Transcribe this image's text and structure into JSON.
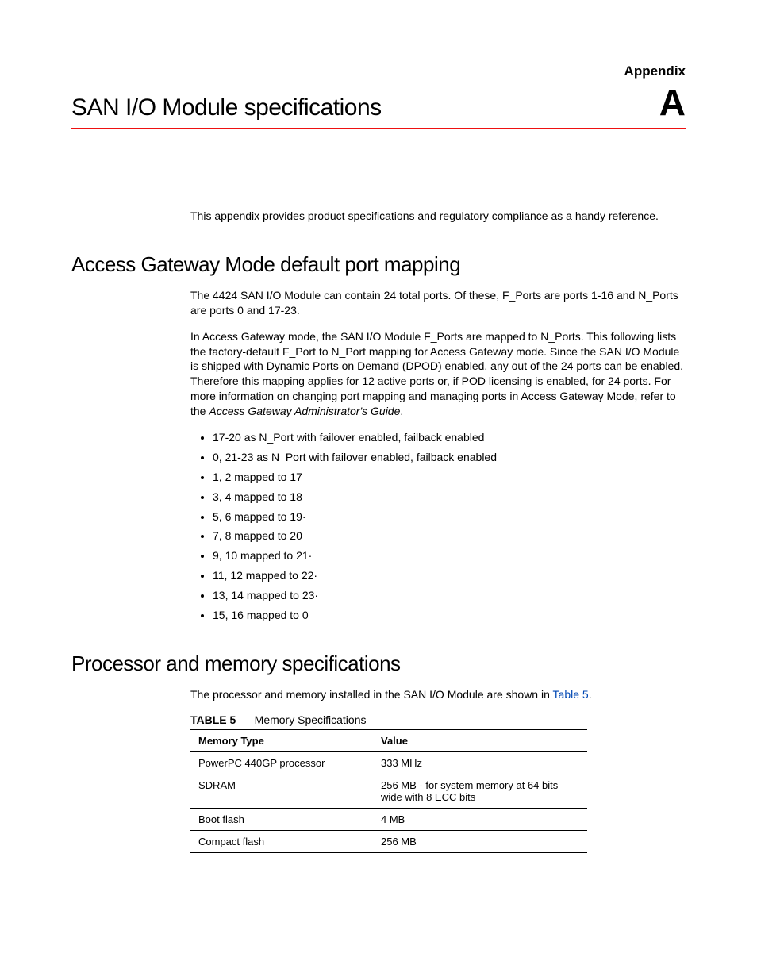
{
  "header": {
    "appendix_label": "Appendix",
    "big_letter": "A",
    "title": "SAN I/O Module specifications"
  },
  "intro": "This appendix provides product specifications and regulatory compliance as a handy reference.",
  "section1": {
    "heading": "Access Gateway Mode default port mapping",
    "p1": "The 4424 SAN I/O Module can contain 24 total ports. Of these, F_Ports are ports 1-16 and N_Ports are ports 0 and 17-23.",
    "p2_a": "In Access Gateway mode, the SAN I/O Module F_Ports are mapped to N_Ports. This following lists the factory-default F_Port to N_Port mapping for Access Gateway mode. Since the SAN I/O Module is shipped with Dynamic Ports on Demand (DPOD) enabled, any out of the 24 ports can be enabled. Therefore this mapping applies for 12 active ports or, if POD licensing is enabled, for 24 ports. For more information on changing port mapping and managing ports in Access Gateway Mode, refer to the ",
    "p2_ref": "Access Gateway Administrator's Guide",
    "p2_b": ".",
    "bullets": [
      "17-20 as N_Port with failover enabled, failback enabled",
      "0, 21-23 as N_Port with failover enabled, failback enabled",
      "1, 2 mapped to 17",
      "3, 4 mapped to 18",
      "5, 6 mapped to 19·",
      "7, 8 mapped to 20",
      "9, 10 mapped to 21·",
      "11, 12 mapped to 22·",
      "13, 14 mapped to 23·",
      "15, 16 mapped to 0"
    ]
  },
  "section2": {
    "heading": "Processor and memory specifications",
    "p1_a": "The processor and memory installed in the SAN I/O Module are shown in ",
    "p1_xref": "Table 5",
    "p1_b": ".",
    "table_label_strong": "TABLE 5",
    "table_label_rest": "Memory Specifications",
    "table": {
      "headers": [
        "Memory Type",
        "Value"
      ],
      "rows": [
        [
          "PowerPC 440GP processor",
          "333 MHz"
        ],
        [
          "SDRAM",
          "256 MB - for system memory at 64 bits wide with 8 ECC bits"
        ],
        [
          "Boot flash",
          "4 MB"
        ],
        [
          "Compact flash",
          "256 MB"
        ]
      ]
    }
  }
}
